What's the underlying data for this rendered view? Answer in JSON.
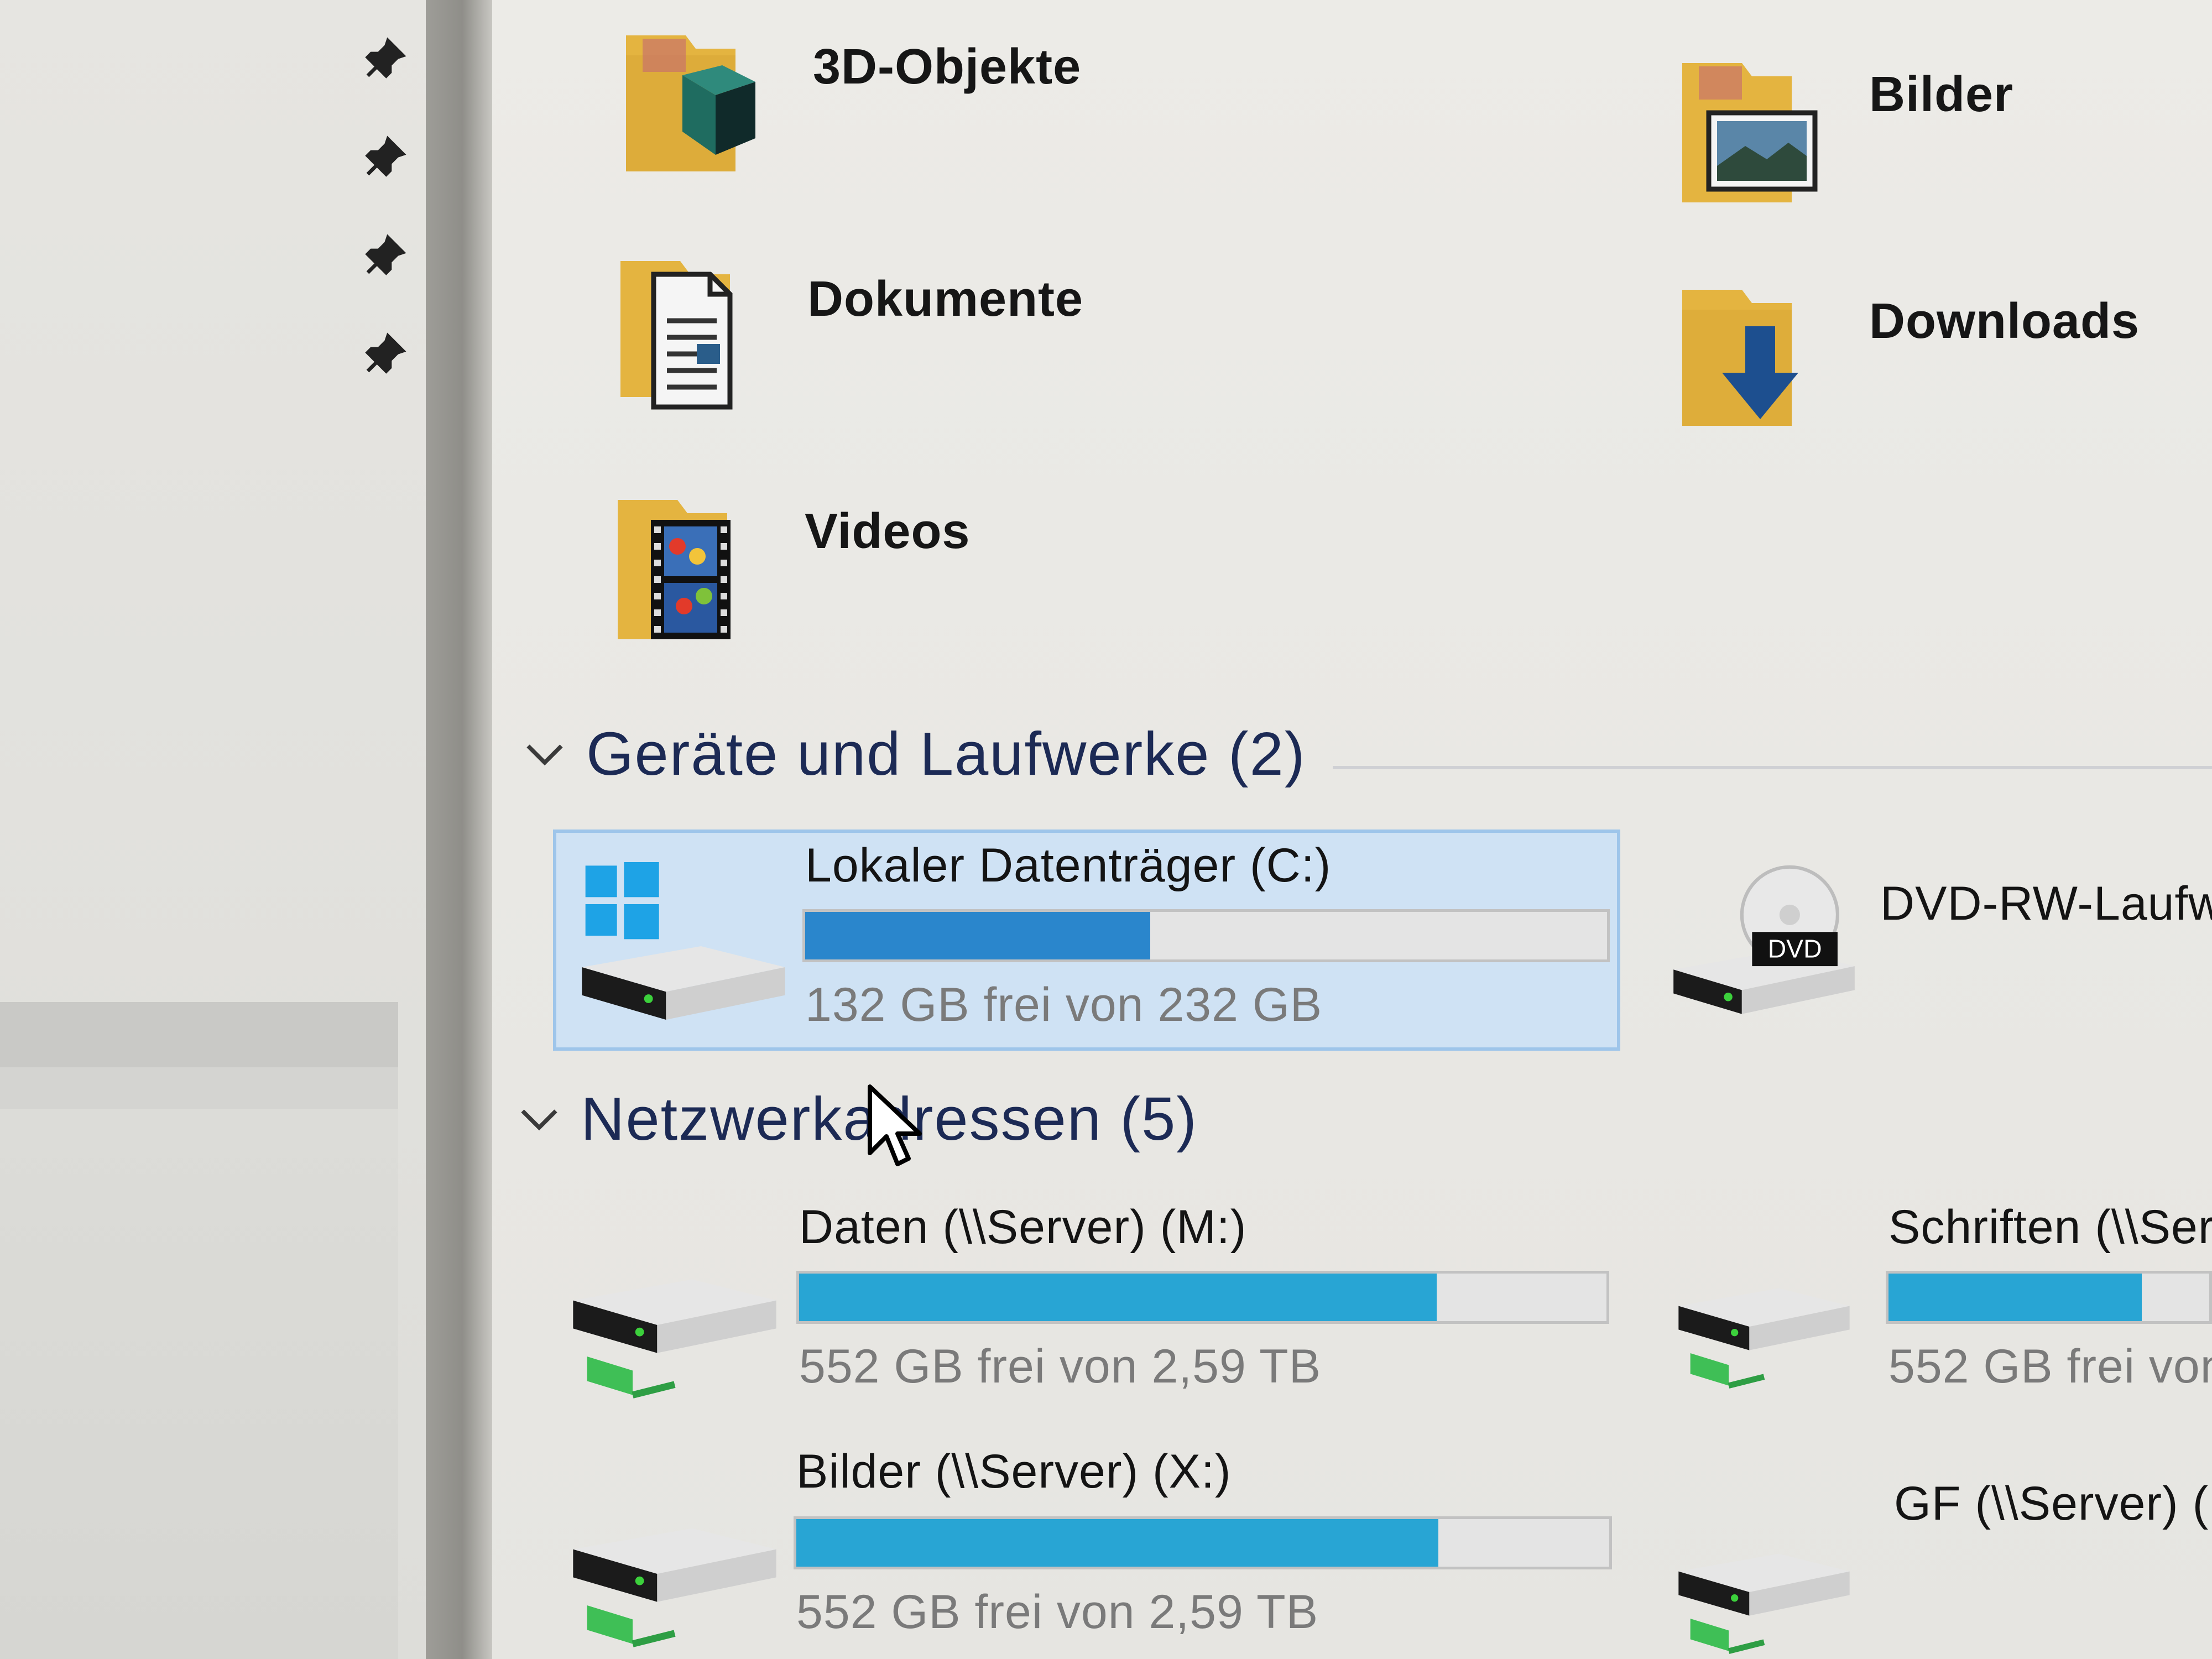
{
  "quick_access_folders": [
    {
      "name": "3D-Objekte",
      "icon": "3d-objects-folder-icon"
    },
    {
      "name": "Bilder",
      "icon": "pictures-folder-icon"
    },
    {
      "name": "Dokumente",
      "icon": "documents-folder-icon"
    },
    {
      "name": "Downloads",
      "icon": "downloads-folder-icon"
    },
    {
      "name": "Videos",
      "icon": "videos-folder-icon"
    }
  ],
  "devices_section": {
    "title": "Geräte und Laufwerke (2)",
    "drives": [
      {
        "name": "Lokaler Datenträger (C:)",
        "free_text": "132 GB frei von 232 GB",
        "used_fraction": 0.43,
        "selected": true
      },
      {
        "name": "DVD-RW-Laufw"
      }
    ]
  },
  "network_section": {
    "title": "Netzwerkadressen (5)",
    "drives": [
      {
        "name": "Daten (\\\\Server) (M:)",
        "free_text": "552 GB frei von 2,59 TB",
        "used_fraction": 0.79
      },
      {
        "name": "Schriften (\\\\Ser",
        "free_text": "552 GB frei von",
        "used_fraction": 0.79
      },
      {
        "name": "Bilder (\\\\Server) (X:)",
        "free_text": "552 GB frei von 2,59 TB",
        "used_fraction": 0.79
      },
      {
        "name": "GF (\\\\Server) ("
      }
    ]
  },
  "colors": {
    "local_bar": "#2a86cc",
    "network_bar": "#28a5d4",
    "selection": "#cfe2f4",
    "section_title": "#1c2a55"
  },
  "dvd_badge": "DVD"
}
